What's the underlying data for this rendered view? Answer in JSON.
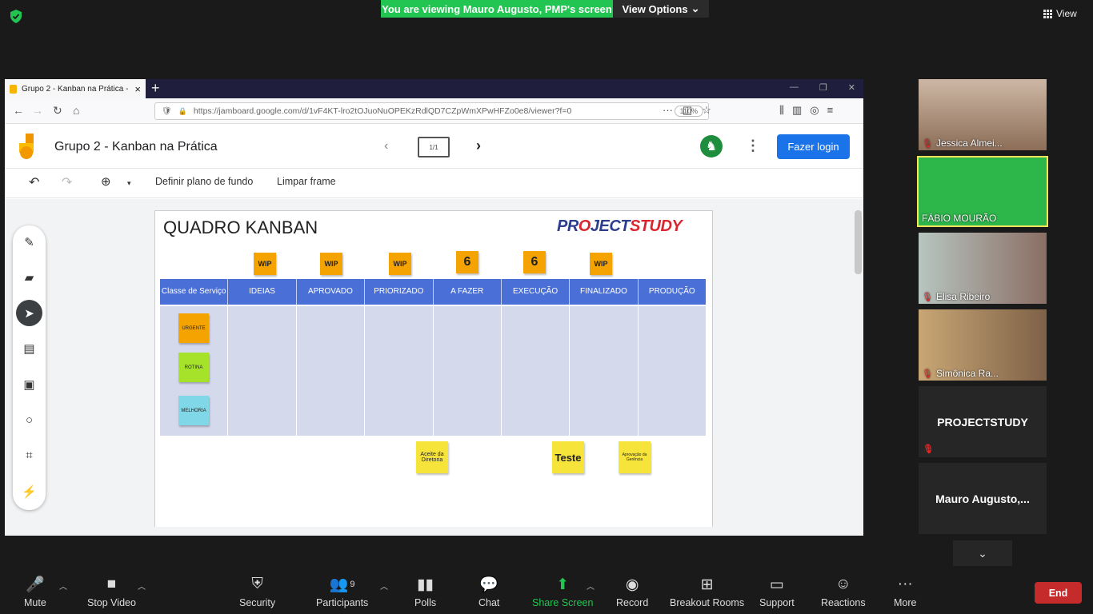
{
  "zoom": {
    "banner": "You are viewing Mauro Augusto, PMP's screen",
    "view_options": "View Options",
    "view_label": "View",
    "toolbar": {
      "mute": "Mute",
      "stop_video": "Stop Video",
      "security": "Security",
      "participants": "Participants",
      "participants_count": "9",
      "polls": "Polls",
      "chat": "Chat",
      "share_screen": "Share Screen",
      "record": "Record",
      "breakout": "Breakout Rooms",
      "support": "Support",
      "reactions": "Reactions",
      "more": "More",
      "end": "End"
    },
    "participants": [
      {
        "name": "Jessica Almei..."
      },
      {
        "name": "FÁBIO MOURÃO"
      },
      {
        "name": "Elisa Ribeiro"
      },
      {
        "name": "Simônica Ra..."
      },
      {
        "name": "PROJECTSTUDY"
      },
      {
        "name": "Mauro  Augusto,..."
      }
    ]
  },
  "browser": {
    "tab_title": "Grupo 2 - Kanban na Prática - J",
    "url": "https://jamboard.google.com/d/1vF4KT-lro2tOJuoNuOPEKzRdlQD7CZpWmXPwHFZo0e8/viewer?f=0",
    "zoom": "110%"
  },
  "jamboard": {
    "title": "Grupo 2 - Kanban na Prática",
    "frame": "1/1",
    "avatar_letter": "♞",
    "login": "Fazer login",
    "set_background": "Definir plano de fundo",
    "clear_frame": "Limpar frame"
  },
  "board": {
    "title": "QUADRO KANBAN",
    "logo_a": "PR",
    "logo_b": "O",
    "logo_c": "JECT",
    "logo_d": "STUDY",
    "wip": [
      "WIP",
      "WIP",
      "WIP",
      "6",
      "6",
      "WIP"
    ],
    "columns": [
      "Classe de Serviço",
      "IDEIAS",
      "APROVADO",
      "PRIORIZADO",
      "A FAZER",
      "EXECUÇÃO",
      "FINALIZADO",
      "PRODUÇÃO"
    ],
    "classes": [
      "URGENTE",
      "ROTINA",
      "MELHORIA"
    ],
    "bottom_notes": [
      "Aceite da Diretoria",
      "Teste",
      "Aprovação da Gerência"
    ],
    "colors": {
      "orange": "#f4a300",
      "green": "#a6e22a",
      "cyan": "#7fd7e8",
      "yellow": "#f7e43a",
      "header": "#4a6fd6",
      "cells": "#d5d9ec"
    }
  }
}
